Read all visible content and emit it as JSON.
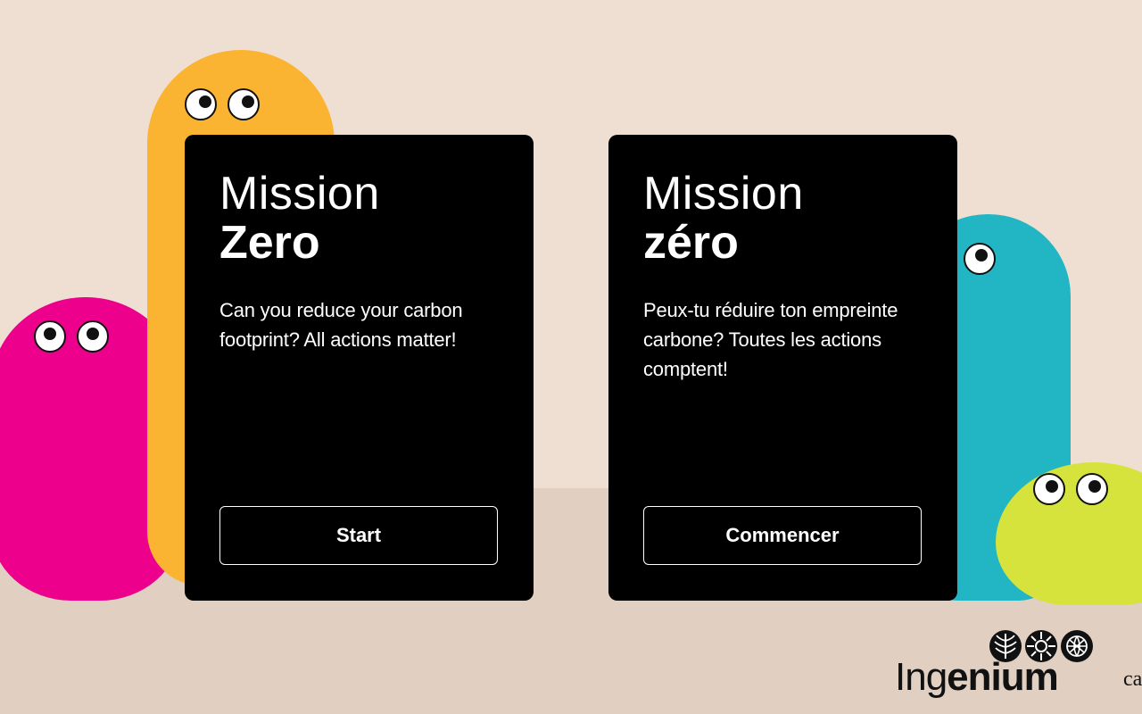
{
  "colors": {
    "background": "#efdfd2",
    "floor": "#e1cfc1",
    "card": "#000000",
    "blob_magenta": "#ec008c",
    "blob_yellow": "#fbb332",
    "blob_teal": "#22b5c4",
    "blob_lime": "#d6e33c"
  },
  "cards": {
    "english": {
      "title_line1": "Mission",
      "title_line2": "Zero",
      "description": "Can you reduce your carbon footprint? All actions matter!",
      "button_label": "Start"
    },
    "french": {
      "title_line1": "Mission",
      "title_line2": "zéro",
      "description": "Peux-tu réduire ton empreinte carbone? Toutes les actions comptent!",
      "button_label": "Commencer"
    }
  },
  "logo": {
    "name_light": "Ing",
    "name_bold": "enium",
    "icons": [
      "wheat-icon",
      "gear-icon",
      "globe-icon"
    ]
  },
  "edge_text": "ca"
}
